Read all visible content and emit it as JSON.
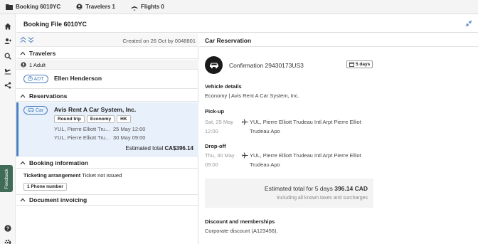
{
  "topbar": {
    "booking_tab": "Booking 6010YC",
    "travelers_tab": "Travelers 1",
    "flights_tab": "Flights 0"
  },
  "feedback_label": "Feedback",
  "header": {
    "title": "Booking File 6010YC"
  },
  "left": {
    "created": "Created on 26 Oct by 0048801",
    "travelers": {
      "heading": "Travelers",
      "count": "1 Adult",
      "type_badge": "ADT",
      "name": "Ellen Henderson"
    },
    "reservations": {
      "heading": "Reservations",
      "car_badge": "Car",
      "vendor": "Avis Rent A Car System, Inc.",
      "tags": [
        "Round trip",
        "Economy",
        "HK"
      ],
      "pickup_loc": "YUL, Pierre Elliott Tru...",
      "pickup_date": "25 May 12:00",
      "dropoff_loc": "YUL, Pierre Elliott Tru...",
      "dropoff_date": "30 May 09:00",
      "total_label": "Estimated total",
      "total_value": "CA$396.14"
    },
    "booking_info": {
      "heading": "Booking information",
      "ticketing_label": "Ticketing arrangement",
      "ticketing_value": "Ticket not issued",
      "phone_tag": "1 Phone number"
    },
    "invoicing": {
      "heading": "Document invoicing"
    }
  },
  "right": {
    "title": "Car Reservation",
    "confirmation": "Confirmation 29430173US3",
    "duration": "5 days",
    "vehicle_heading": "Vehicle details",
    "vehicle_value": "Economy | Avis Rent A Car System, Inc.",
    "pickup_heading": "Pick-up",
    "pickup_date": "Sat, 25 May",
    "pickup_time": "12:00",
    "pickup_loc1": "YUL, Pierre Elliott Trudeau Intl Arpt Pierre Elliot",
    "pickup_loc2": "Trudeau Apo",
    "dropoff_heading": "Drop-off",
    "dropoff_date": "Thu, 30 May",
    "dropoff_time": "09:00",
    "dropoff_loc1": "YUL, Pierre Elliott Trudeau Intl Arpt Pierre Elliot",
    "dropoff_loc2": "Trudeau Apo",
    "total_label": "Estimated total for 5 days",
    "total_value": "396.14 CAD",
    "total_note": "Including all known taxes and surcharges",
    "discount_heading": "Discount and memberships",
    "discount_value": "Corporate discount (A123456)."
  },
  "colors": {
    "accent_blue": "#4a7fbf",
    "selected_bg": "#e8f1fb",
    "feedback_green": "#3f6b57"
  }
}
